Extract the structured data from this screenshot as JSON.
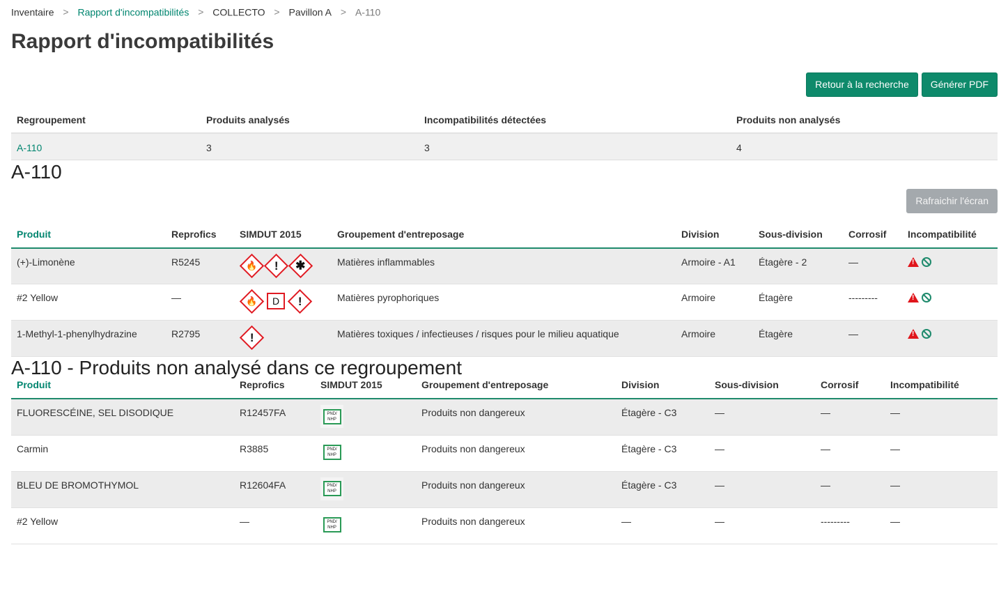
{
  "breadcrumb": {
    "items": [
      "Inventaire",
      "Rapport d'incompatibilités",
      "COLLECTO",
      "Pavillon A",
      "A-110"
    ],
    "separator": ">"
  },
  "page_title": "Rapport d'incompatibilités",
  "actions": {
    "back_label": "Retour à la recherche",
    "pdf_label": "Générer PDF"
  },
  "summary": {
    "headers": [
      "Regroupement",
      "Produits analysés",
      "Incompatibilités détectées",
      "Produits non analysés"
    ],
    "row": {
      "group": "A-110",
      "analysed": "3",
      "detected": "3",
      "not_analysed": "4"
    }
  },
  "section1": {
    "title": "A-110",
    "refresh_label": "Rafraichir l'écran",
    "headers": [
      "Produit",
      "Reprofics",
      "SIMDUT 2015",
      "Groupement d'entreposage",
      "Division",
      "Sous-division",
      "Corrosif",
      "Incompatibilité"
    ],
    "rows": [
      {
        "product": "(+)-Limonène",
        "reprofics": "R5245",
        "pictos": [
          "flame-icon",
          "exclamation-icon",
          "health-hazard-icon"
        ],
        "storage": "Matières inflammables",
        "division": "Armoire - A1",
        "subdivision": "Étagère - 2",
        "corrosive": "—"
      },
      {
        "product": "#2 Yellow",
        "reprofics": "—",
        "pictos": [
          "flame-icon",
          "class-d-icon",
          "exclamation-icon"
        ],
        "storage": "Matières pyrophoriques",
        "division": "Armoire",
        "subdivision": "Étagère",
        "corrosive": "---------"
      },
      {
        "product": "1-Methyl-1-phenylhydrazine",
        "reprofics": "R2795",
        "pictos": [
          "exclamation-icon"
        ],
        "storage": "Matières toxiques / infectieuses / risques pour le milieu aquatique",
        "division": "Armoire",
        "subdivision": "Étagère",
        "corrosive": "—"
      }
    ],
    "picto_glyphs": {
      "flame": "🔥",
      "exclamation": "!",
      "health": "✱",
      "class_d": "D"
    },
    "incompat_glyphs": {
      "warning": "!"
    }
  },
  "section2": {
    "title": "A-110 - Produits non analysé dans ce regroupement",
    "headers": [
      "Produit",
      "Reprofics",
      "SIMDUT 2015",
      "Groupement d'entreposage",
      "Division",
      "Sous-division",
      "Corrosif",
      "Incompatibilité"
    ],
    "pnd_label_top": "PND/",
    "pnd_label_bottom": "NHP",
    "rows": [
      {
        "product": "FLUORESCÉINE, SEL DISODIQUE",
        "reprofics": "R12457FA",
        "storage": "Produits non dangereux",
        "division": "Étagère - C3",
        "subdivision": "—",
        "corrosive": "—",
        "incompat": "—"
      },
      {
        "product": "Carmin",
        "reprofics": "R3885",
        "storage": "Produits non dangereux",
        "division": "Étagère - C3",
        "subdivision": "—",
        "corrosive": "—",
        "incompat": "—"
      },
      {
        "product": "BLEU DE BROMOTHYMOL",
        "reprofics": "R12604FA",
        "storage": "Produits non dangereux",
        "division": "Étagère - C3",
        "subdivision": "—",
        "corrosive": "—",
        "incompat": "—"
      },
      {
        "product": "#2 Yellow",
        "reprofics": "—",
        "storage": "Produits non dangereux",
        "division": "—",
        "subdivision": "—",
        "corrosive": "---------",
        "incompat": "—"
      }
    ]
  },
  "colors": {
    "accent": "#00856f",
    "button": "#0e8a6b",
    "danger": "#e01a22",
    "disabled": "#a4a9ad"
  }
}
